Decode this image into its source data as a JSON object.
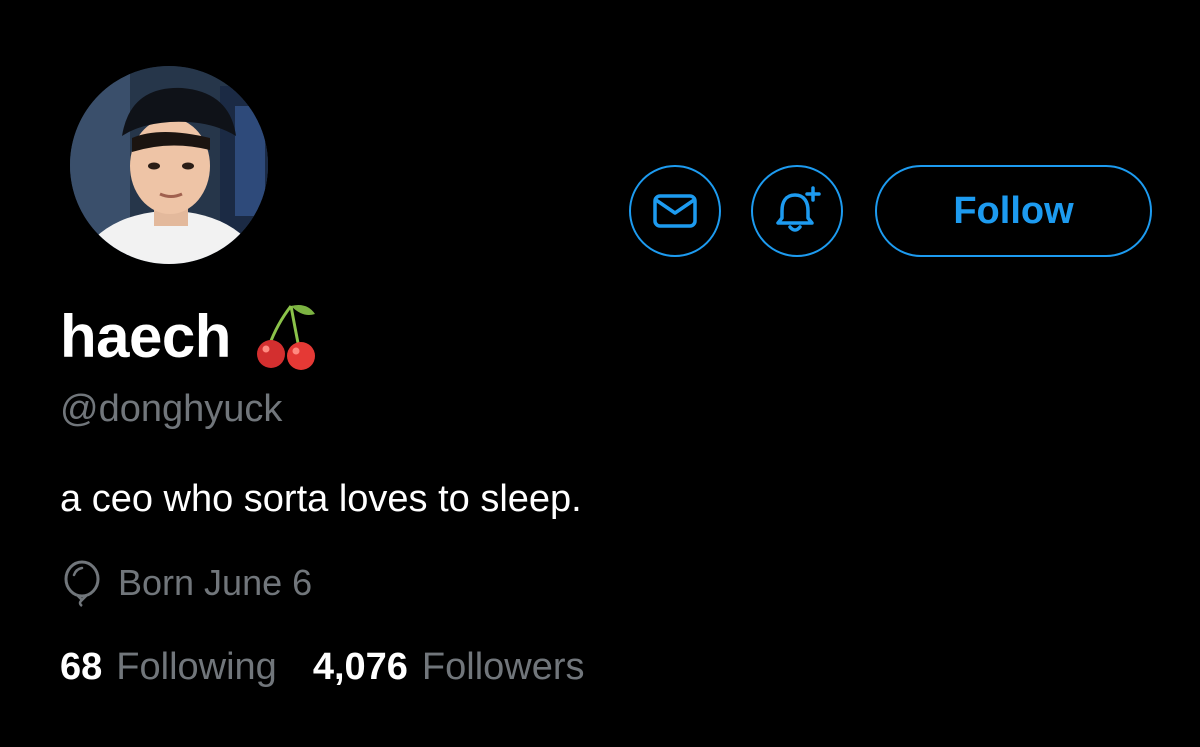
{
  "profile": {
    "display_name": "haech",
    "name_emoji": "cherries-icon",
    "handle": "@donghyuck",
    "bio": "a ceo who sorta loves to sleep.",
    "birth": "Born June 6",
    "birth_icon": "balloon-icon",
    "avatar_icon": "avatar"
  },
  "actions": {
    "message_icon": "envelope-icon",
    "notify_icon": "bell-plus-icon",
    "follow_label": "Follow"
  },
  "stats": {
    "following_count": "68",
    "following_label": "Following",
    "followers_count": "4,076",
    "followers_label": "Followers"
  },
  "colors": {
    "background": "#000000",
    "accent": "#1d9bf0",
    "primary_text": "#ffffff",
    "secondary_text": "#71767b"
  }
}
